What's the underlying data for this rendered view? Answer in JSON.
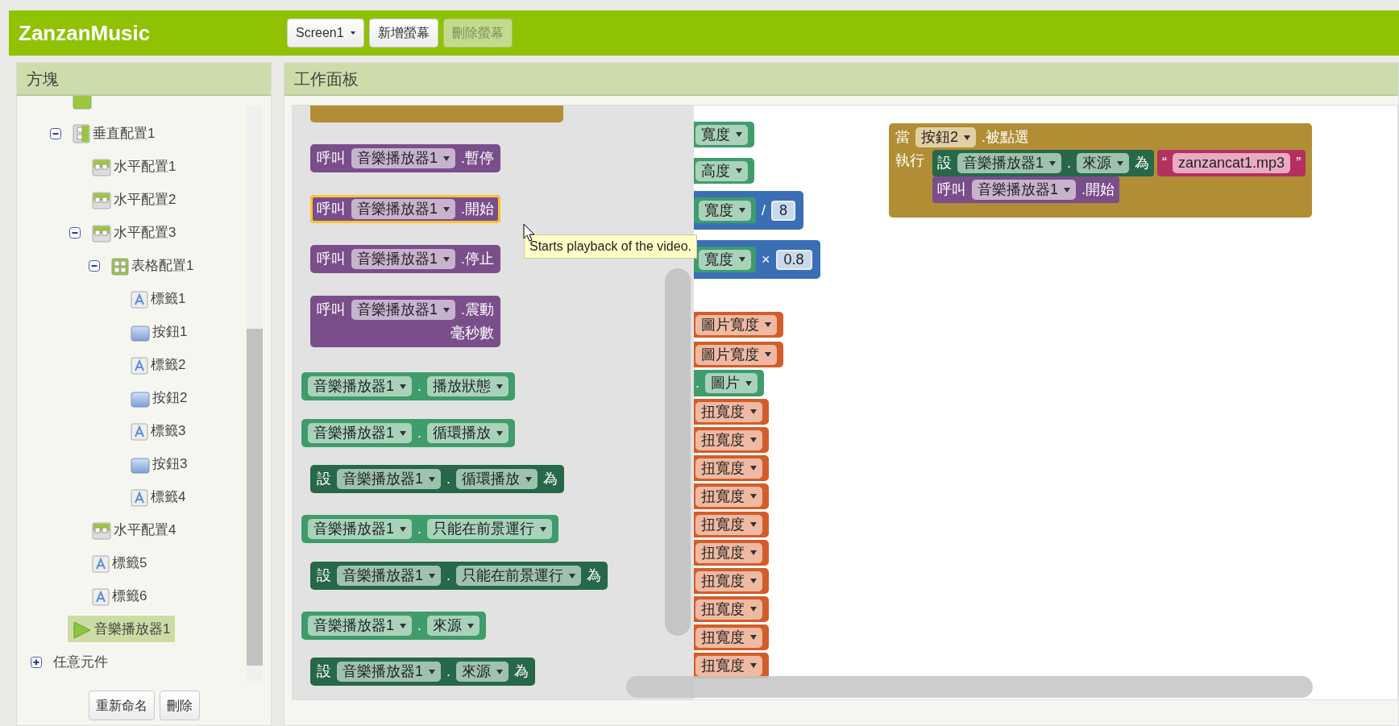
{
  "app": {
    "title": "ZanzanMusic"
  },
  "toolbar": [
    {
      "kind": "dropdown",
      "label": "Screen1",
      "disabled": false
    },
    {
      "kind": "button",
      "label": "新增螢幕",
      "disabled": false
    },
    {
      "kind": "button",
      "label": "刪除螢幕",
      "disabled": true
    }
  ],
  "blocks_panel": {
    "title": "方塊",
    "tree": [
      {
        "kind": "image",
        "selected": false
      },
      {
        "label": "垂直配置1",
        "kind": "vertical",
        "selected": false,
        "expanded": true,
        "children": [
          {
            "label": "水平配置1",
            "kind": "horizontal",
            "selected": false
          },
          {
            "label": "水平配置2",
            "kind": "horizontal",
            "selected": false
          },
          {
            "label": "水平配置3",
            "kind": "horizontal",
            "selected": false,
            "expanded": true,
            "children": [
              {
                "label": "表格配置1",
                "kind": "table",
                "selected": false,
                "expanded": true,
                "children": [
                  {
                    "label": "標籤1",
                    "kind": "label",
                    "selected": false
                  },
                  {
                    "label": "按鈕1",
                    "kind": "button",
                    "selected": false
                  },
                  {
                    "label": "標籤2",
                    "kind": "label",
                    "selected": false
                  },
                  {
                    "label": "按鈕2",
                    "kind": "button",
                    "selected": false
                  },
                  {
                    "label": "標籤3",
                    "kind": "label",
                    "selected": false
                  },
                  {
                    "label": "按鈕3",
                    "kind": "button",
                    "selected": false
                  },
                  {
                    "label": "標籤4",
                    "kind": "label",
                    "selected": false
                  }
                ]
              }
            ]
          },
          {
            "label": "水平配置4",
            "kind": "horizontal",
            "selected": false
          },
          {
            "label": "標籤5",
            "kind": "label",
            "selected": false
          },
          {
            "label": "標籤6",
            "kind": "label",
            "selected": false
          }
        ]
      },
      {
        "label": "音樂播放器1",
        "kind": "player",
        "selected": true
      }
    ],
    "any_component": {
      "label": "任意元件",
      "expanded": false,
      "selected": false
    },
    "buttons": [
      "重新命名",
      "刪除"
    ]
  },
  "workspace": {
    "title": "工作面板",
    "flyout": [
      {
        "kind": "call",
        "selected": false,
        "rows": [
          [
            {
              "kind": "label",
              "text": "呼叫"
            },
            {
              "kind": "dropdown",
              "text": "音樂播放器1"
            },
            {
              "kind": "label",
              "text": ".暫停"
            }
          ]
        ]
      },
      {
        "kind": "call",
        "selected": true,
        "rows": [
          [
            {
              "kind": "label",
              "text": "呼叫"
            },
            {
              "kind": "dropdown",
              "text": "音樂播放器1"
            },
            {
              "kind": "label",
              "text": ".開始"
            }
          ]
        ]
      },
      {
        "kind": "call",
        "selected": false,
        "rows": [
          [
            {
              "kind": "label",
              "text": "呼叫"
            },
            {
              "kind": "dropdown",
              "text": "音樂播放器1"
            },
            {
              "kind": "label",
              "text": ".停止"
            }
          ]
        ]
      },
      {
        "kind": "call",
        "selected": false,
        "rows": [
          [
            {
              "kind": "label",
              "text": "呼叫"
            },
            {
              "kind": "dropdown",
              "text": "音樂播放器1"
            },
            {
              "kind": "label",
              "text": ".震動"
            }
          ]
        ],
        "arg_label": "毫秒數"
      },
      {
        "kind": "getter",
        "selected": false,
        "rows": [
          [
            {
              "kind": "dropdown",
              "text": "音樂播放器1"
            },
            {
              "kind": "label",
              "text": "."
            },
            {
              "kind": "dropdown",
              "text": "播放狀態"
            }
          ]
        ]
      },
      {
        "kind": "getter",
        "selected": false,
        "rows": [
          [
            {
              "kind": "dropdown",
              "text": "音樂播放器1"
            },
            {
              "kind": "label",
              "text": "."
            },
            {
              "kind": "dropdown",
              "text": "循環播放"
            }
          ]
        ]
      },
      {
        "kind": "setter",
        "selected": false,
        "rows": [
          [
            {
              "kind": "label",
              "text": "設"
            },
            {
              "kind": "dropdown",
              "text": "音樂播放器1"
            },
            {
              "kind": "label",
              "text": "."
            },
            {
              "kind": "dropdown",
              "text": "循環播放"
            },
            {
              "kind": "label",
              "text": "為"
            }
          ]
        ]
      },
      {
        "kind": "getter",
        "selected": false,
        "rows": [
          [
            {
              "kind": "dropdown",
              "text": "音樂播放器1"
            },
            {
              "kind": "label",
              "text": "."
            },
            {
              "kind": "dropdown",
              "text": "只能在前景運行"
            }
          ]
        ]
      },
      {
        "kind": "setter",
        "selected": false,
        "rows": [
          [
            {
              "kind": "label",
              "text": "設"
            },
            {
              "kind": "dropdown",
              "text": "音樂播放器1"
            },
            {
              "kind": "label",
              "text": "."
            },
            {
              "kind": "dropdown",
              "text": "只能在前景運行"
            },
            {
              "kind": "label",
              "text": "為"
            }
          ]
        ]
      },
      {
        "kind": "getter",
        "selected": false,
        "rows": [
          [
            {
              "kind": "dropdown",
              "text": "音樂播放器1"
            },
            {
              "kind": "label",
              "text": "."
            },
            {
              "kind": "dropdown",
              "text": "來源"
            }
          ]
        ]
      },
      {
        "kind": "setter",
        "selected": false,
        "rows": [
          [
            {
              "kind": "label",
              "text": "設"
            },
            {
              "kind": "dropdown",
              "text": "音樂播放器1"
            },
            {
              "kind": "label",
              "text": "."
            },
            {
              "kind": "dropdown",
              "text": "來源"
            },
            {
              "kind": "label",
              "text": "為"
            }
          ]
        ]
      }
    ],
    "tooltip": "Starts playback of the video.",
    "event": {
      "header": [
        {
          "kind": "label",
          "text": "當"
        },
        {
          "kind": "dropdown",
          "text": "按鈕2"
        },
        {
          "kind": "label",
          "text": ".被點選"
        }
      ],
      "body_label": "執行",
      "statements": [
        {
          "kind": "setter",
          "parts": [
            {
              "kind": "label",
              "text": "設"
            },
            {
              "kind": "dropdown",
              "text": "音樂播放器1"
            },
            {
              "kind": "label",
              "text": "."
            },
            {
              "kind": "dropdown",
              "text": "來源"
            },
            {
              "kind": "label",
              "text": "為"
            }
          ],
          "input": {
            "open_quote": "“",
            "value": "zanzancat1.mp3",
            "close_quote": "”"
          }
        },
        {
          "kind": "call",
          "parts": [
            {
              "kind": "label",
              "text": "呼叫"
            },
            {
              "kind": "dropdown",
              "text": "音樂播放器1"
            },
            {
              "kind": "label",
              "text": ".開始"
            }
          ]
        }
      ]
    },
    "background_blocks": [
      {
        "kind": "getter",
        "parts": [
          {
            "kind": "dropdown",
            "text": "寬度"
          }
        ]
      },
      {
        "kind": "getter",
        "parts": [
          {
            "kind": "dropdown",
            "text": "高度"
          }
        ]
      },
      {
        "kind": "math",
        "parts": [
          {
            "kind": "getter",
            "parts": [
              {
                "kind": "dropdown",
                "text": "寬度"
              }
            ]
          },
          {
            "kind": "label",
            "text": "/"
          },
          {
            "kind": "number",
            "text": "8"
          }
        ]
      },
      {
        "kind": "math",
        "parts": [
          {
            "kind": "getter",
            "parts": [
              {
                "kind": "dropdown",
                "text": "寬度"
              }
            ]
          },
          {
            "kind": "label",
            "text": "×"
          },
          {
            "kind": "number",
            "text": "0.8"
          }
        ]
      },
      {
        "kind": "variable",
        "parts": [
          {
            "kind": "dropdown",
            "text": "圖片寬度"
          }
        ]
      },
      {
        "kind": "variable",
        "parts": [
          {
            "kind": "dropdown",
            "text": "圖片寬度"
          }
        ]
      },
      {
        "kind": "getter",
        "parts": [
          {
            "kind": "label",
            "text": "."
          },
          {
            "kind": "dropdown",
            "text": "圖片"
          }
        ]
      },
      {
        "kind": "variable",
        "parts": [
          {
            "kind": "dropdown",
            "text": "扭寬度"
          }
        ]
      },
      {
        "kind": "variable",
        "parts": [
          {
            "kind": "dropdown",
            "text": "扭寬度"
          }
        ]
      },
      {
        "kind": "variable",
        "parts": [
          {
            "kind": "dropdown",
            "text": "扭寬度"
          }
        ]
      },
      {
        "kind": "variable",
        "parts": [
          {
            "kind": "dropdown",
            "text": "扭寬度"
          }
        ]
      },
      {
        "kind": "variable",
        "parts": [
          {
            "kind": "dropdown",
            "text": "扭寬度"
          }
        ]
      },
      {
        "kind": "variable",
        "parts": [
          {
            "kind": "dropdown",
            "text": "扭寬度"
          }
        ]
      },
      {
        "kind": "variable",
        "parts": [
          {
            "kind": "dropdown",
            "text": "扭寬度"
          }
        ]
      },
      {
        "kind": "variable",
        "parts": [
          {
            "kind": "dropdown",
            "text": "扭寬度"
          }
        ]
      },
      {
        "kind": "variable",
        "parts": [
          {
            "kind": "dropdown",
            "text": "扭寬度"
          }
        ]
      },
      {
        "kind": "variable",
        "parts": [
          {
            "kind": "dropdown",
            "text": "扭寬度"
          }
        ]
      }
    ]
  }
}
